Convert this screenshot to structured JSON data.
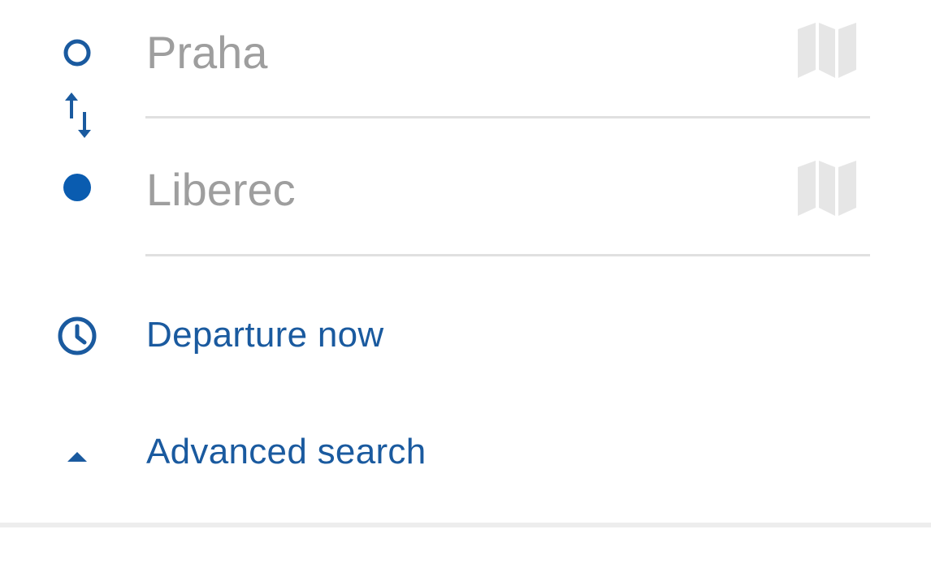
{
  "search_form": {
    "origin": {
      "value": "",
      "placeholder": "Praha",
      "icon": "origin-circle-icon"
    },
    "swap_icon": "swap-arrows-icon",
    "destination": {
      "value": "",
      "placeholder": "Liberec",
      "icon": "destination-dot-icon"
    },
    "map_icon": "map-icon",
    "departure": {
      "label": "Departure now",
      "icon": "clock-icon"
    },
    "advanced": {
      "label": "Advanced search",
      "icon": "caret-up-icon"
    }
  },
  "colors": {
    "accent": "#1a5a9f",
    "field_text": "#9e9e9e",
    "map_icon": "#e6e6e6",
    "divider": "#ededed"
  }
}
